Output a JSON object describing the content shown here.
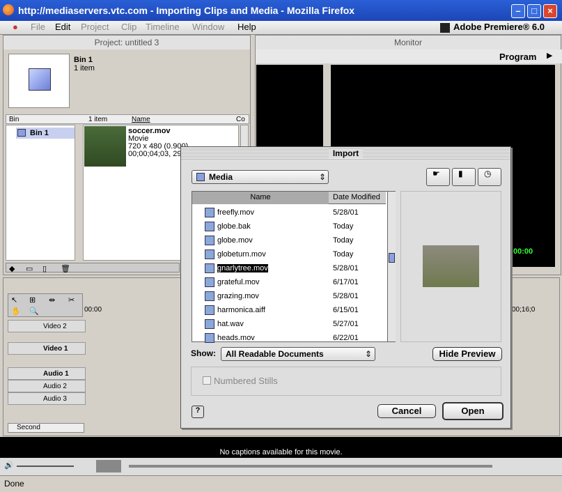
{
  "window": {
    "title": "http://mediaservers.vtc.com - Importing Clips and Media - Mozilla Firefox"
  },
  "menu": {
    "items": [
      "File",
      "Edit",
      "Project",
      "Clip",
      "Timeline",
      "Window",
      "Help"
    ],
    "app": "Adobe Premiere® 6.0"
  },
  "project": {
    "title": "Project: untitled 3",
    "bin_name": "Bin 1",
    "bin_count": "1 item",
    "col_bin": "Bin",
    "col_count": "1 item",
    "col_name": "Name",
    "col_extra": "Co",
    "tree_item": "Bin 1",
    "clip": {
      "name": "soccer.mov",
      "type": "Movie",
      "dims": "720 x 480 (0.900)",
      "duration": "00;00;04;03, 29"
    }
  },
  "monitor": {
    "title": "Monitor",
    "program": "Program",
    "timecode": "00:00"
  },
  "timeline": {
    "start_tc": "00:00",
    "end_tc": "00;16;0",
    "tracks": [
      "Video 2",
      "Video 1",
      "Audio 1",
      "Audio 2",
      "Audio 3"
    ],
    "zoom": "Second"
  },
  "dialog": {
    "title": "Import",
    "folder": "Media",
    "col_name": "Name",
    "col_date": "Date Modified",
    "files": [
      {
        "name": "freefly.mov",
        "date": "5/28/01"
      },
      {
        "name": "globe.bak",
        "date": "Today"
      },
      {
        "name": "globe.mov",
        "date": "Today"
      },
      {
        "name": "globeturn.mov",
        "date": "Today"
      },
      {
        "name": "gnarlytree.mov",
        "date": "5/28/01",
        "selected": true
      },
      {
        "name": "grateful.mov",
        "date": "6/17/01"
      },
      {
        "name": "grazing.mov",
        "date": "5/28/01"
      },
      {
        "name": "harmonica.aiff",
        "date": "6/15/01"
      },
      {
        "name": "hat.wav",
        "date": "5/27/01"
      },
      {
        "name": "heads.mov",
        "date": "6/22/01"
      }
    ],
    "show_label": "Show:",
    "show_value": "All Readable Documents",
    "hide_preview": "Hide Preview",
    "numbered_stills": "Numbered Stills",
    "cancel": "Cancel",
    "open": "Open"
  },
  "player": {
    "caption": "No captions available for this movie."
  },
  "status": {
    "text": "Done"
  }
}
